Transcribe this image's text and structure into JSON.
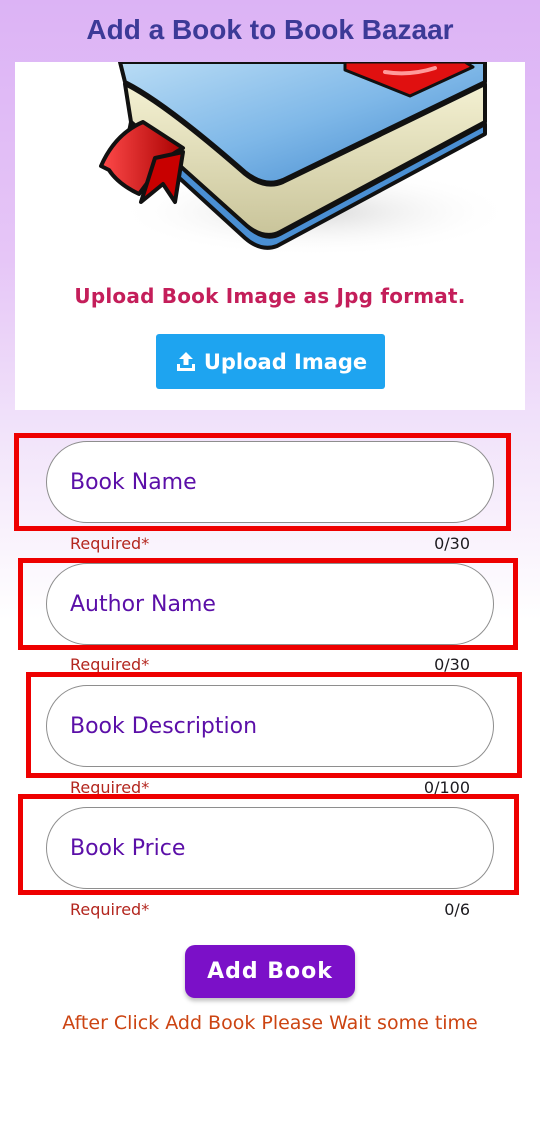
{
  "header": {
    "title": "Add a Book to Book Bazaar"
  },
  "image_upload": {
    "placeholder_image": "book-illustration",
    "hint": "Upload Book Image as Jpg format.",
    "button_label": "Upload Image",
    "button_icon": "upload-icon"
  },
  "form": {
    "fields": [
      {
        "placeholder": "Book Name",
        "value": "",
        "helper": "Required*",
        "counter": "0/30",
        "max_length": 30
      },
      {
        "placeholder": "Author Name",
        "value": "",
        "helper": "Required*",
        "counter": "0/30",
        "max_length": 30
      },
      {
        "placeholder": "Book Description",
        "value": "",
        "helper": "Required*",
        "counter": "0/100",
        "max_length": 100
      },
      {
        "placeholder": "Book Price",
        "value": "",
        "helper": "Required*",
        "counter": "0/6",
        "max_length": 6
      }
    ],
    "submit_label": "Add Book",
    "note": "After Click Add Book Please Wait some time"
  },
  "colors": {
    "title": "#3c3a97",
    "hint": "#c41e5a",
    "upload_button": "#1ea4f0",
    "field_text": "#5b0fa8",
    "highlight_outline": "#ee0000",
    "helper_text": "#b3261e",
    "submit_button": "#7b10c8",
    "note_text": "#cc4412"
  }
}
